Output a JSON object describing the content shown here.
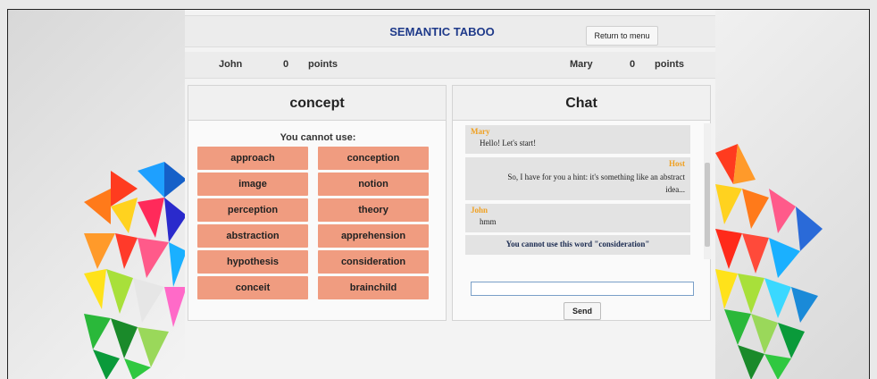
{
  "header": {
    "title": "SEMANTIC TABOO",
    "menu_button": "Return to menu"
  },
  "scores": {
    "left": {
      "name": "John",
      "points": "0",
      "unit": "points"
    },
    "right": {
      "name": "Mary",
      "points": "0",
      "unit": "points"
    }
  },
  "concept": {
    "title": "concept",
    "cannot_use_label": "You cannot use:",
    "words_left": [
      "approach",
      "image",
      "perception",
      "abstraction",
      "hypothesis",
      "conceit"
    ],
    "words_right": [
      "conception",
      "notion",
      "theory",
      "apprehension",
      "consideration",
      "brainchild"
    ]
  },
  "chat": {
    "title": "Chat",
    "messages": [
      {
        "sender": "Mary",
        "text": "Hello! Let's start!"
      },
      {
        "sender": "Host",
        "text": "So, I have for you a hint: it's something like an abstract idea..."
      },
      {
        "sender": "John",
        "text": "hmm"
      },
      {
        "sender": "",
        "text": "You cannot use this word \"consideration\""
      }
    ],
    "input_value": "",
    "send_label": "Send"
  },
  "colors": {
    "title_blue": "#1f3a8a",
    "word_tile": "#f09c80",
    "sender_orange": "#f0a020"
  }
}
